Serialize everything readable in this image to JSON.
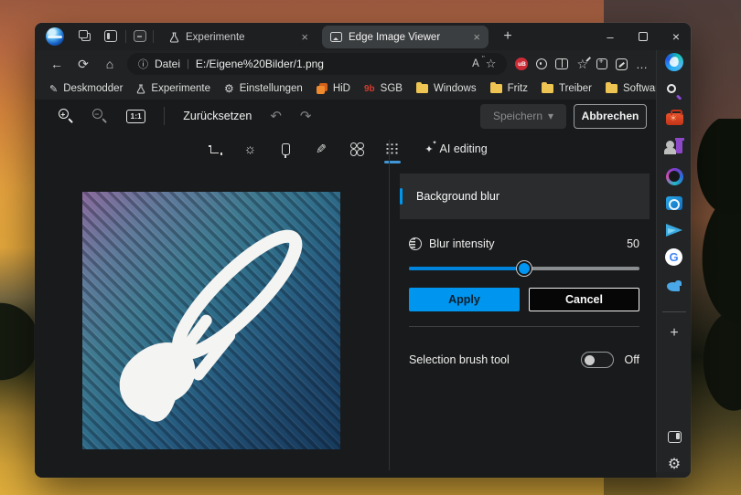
{
  "window": {
    "tabs": [
      {
        "label": "Experimente"
      },
      {
        "label": "Edge Image Viewer"
      }
    ],
    "address": {
      "scheme_label": "Datei",
      "url": "E:/Eigene%20Bilder/1.png"
    },
    "bookmarks": [
      {
        "label": "Deskmodder"
      },
      {
        "label": "Experimente"
      },
      {
        "label": "Einstellungen"
      },
      {
        "label": "HiD"
      },
      {
        "label": "SGB",
        "badge": "9b"
      },
      {
        "label": "Windows"
      },
      {
        "label": "Fritz"
      },
      {
        "label": "Treiber"
      },
      {
        "label": "Software"
      }
    ],
    "ublock_badge": "uB",
    "google_badge": "G"
  },
  "viewer": {
    "toolbar": {
      "ratio": "1:1",
      "reset": "Zurücksetzen",
      "save": "Speichern",
      "cancel": "Abbrechen"
    },
    "ai_editing": "AI editing",
    "panel": {
      "title": "Background blur",
      "intensity_label": "Blur intensity",
      "intensity_value": "50",
      "intensity_percent": 50,
      "apply": "Apply",
      "cancel": "Cancel",
      "brush_label": "Selection brush tool",
      "brush_state": "Off"
    }
  },
  "glyphs": {
    "back": "←",
    "refresh": "⟳",
    "home": "⌂",
    "info": "ⓘ",
    "read_aloud": "A",
    "favorite_star": "☆",
    "favorites_bar": "☆",
    "more": "…",
    "new_tab": "+",
    "close": "×",
    "minimize": "–",
    "undo": "↶",
    "redo": "↷",
    "chevron_down": "▾",
    "bookmarks_overflow": "›",
    "pen": "✎",
    "gear": "⚙",
    "brightness": "☼",
    "sparkle": "✦",
    "plus": "+",
    "url_divider": "|"
  },
  "colors": {
    "accent": "#0095ee",
    "slider_fill": "#0084db",
    "apply_button": "#0095ee"
  }
}
